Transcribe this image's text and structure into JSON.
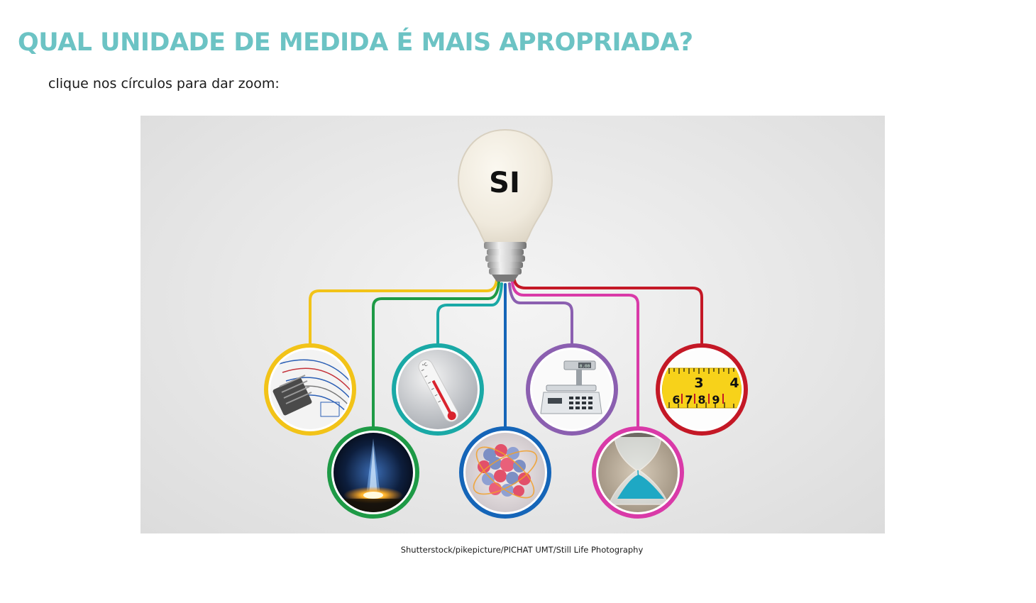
{
  "page": {
    "title": "QUAL UNIDADE DE MEDIDA É MAIS APROPRIADA?",
    "instruction": "clique nos círculos para dar zoom:",
    "credit": "Shutterstock/pikepicture/PICHAT UMT/Still Life Photography"
  },
  "bulb": {
    "label": "SI"
  },
  "tape": {
    "digits_top": [
      "3",
      "4"
    ],
    "digits_bottom": [
      "6",
      "7",
      "8",
      "9"
    ]
  },
  "scale": {
    "display": "0.00"
  },
  "thermometer": {
    "unit": "°C"
  },
  "colors": {
    "title": "#6cc3c4",
    "yellow": "#f2c318",
    "green": "#1e9a46",
    "teal": "#1aa9a6",
    "blue": "#1565b8",
    "purple": "#8b5fb0",
    "magenta": "#d93aa8",
    "red": "#c41826"
  }
}
